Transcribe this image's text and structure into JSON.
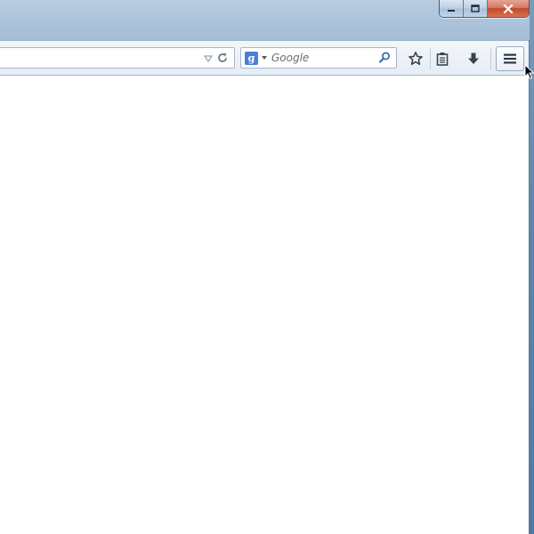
{
  "window": {
    "caption_buttons": [
      {
        "name": "minimize",
        "icon": "minimize-icon"
      },
      {
        "name": "maximize",
        "icon": "maximize-icon"
      },
      {
        "name": "close",
        "icon": "close-icon"
      }
    ]
  },
  "navbar": {
    "urlbar": {
      "value": "",
      "dropmarker_icon": "dropdown-triangle-icon",
      "reload_icon": "reload-icon"
    },
    "searchbar": {
      "engine_letter": "g",
      "engine_icon": "google-logo-icon",
      "placeholder": "Google",
      "go_icon": "search-magnifier-icon"
    },
    "toolbar_buttons": [
      {
        "name": "bookmark",
        "icon": "star-icon"
      },
      {
        "name": "bookmarks-menu",
        "icon": "clipboard-icon"
      },
      {
        "name": "downloads",
        "icon": "download-arrow-icon"
      },
      {
        "name": "menu",
        "icon": "hamburger-menu-icon"
      }
    ]
  },
  "colors": {
    "titlebar": "#abc3da",
    "close_button": "#c2492c",
    "toolbar": "#e6edf5",
    "content": "#ffffff",
    "engine_logo": "#4a7ed8"
  }
}
